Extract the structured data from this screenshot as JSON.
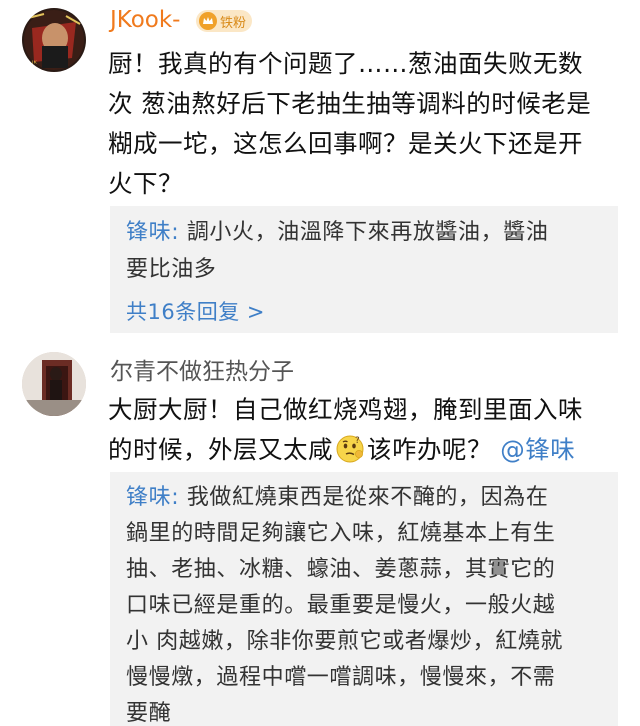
{
  "comments": [
    {
      "username": "JKook-",
      "badge": "铁粉",
      "text": "厨！我真的有个问题了……葱油面失败无数次 葱油熬好后下老抽生抽等调料的时候老是糊成一坨，这怎么回事啊？是关火下还是开火下？",
      "text_lines": [
        "厨！我真的有个问题了……葱油面失败无数",
        "次 葱油熬好后下老抽生抽等调料的时候老是",
        "糊成一坨，这怎么回事啊？是关火下还是开",
        "火下？"
      ],
      "reply": {
        "author": "锋味",
        "separator": ": ",
        "text_lines": [
          "調小火，油溫降下來再放醬油，醬油",
          "要比油多"
        ]
      },
      "more_replies": "共16条回复 >"
    },
    {
      "username": "尔青不做狂热分子",
      "text_lines_1": "大厨大厨！自己做红烧鸡翅，腌到里面入味",
      "text_line_2a": "的时候，外层又太咸",
      "emoji": "thinking-face-emoji",
      "text_line_2b": "该咋办呢？",
      "mention": "@锋味",
      "reply": {
        "author": "锋味",
        "separator": ": ",
        "text_lines": [
          "我做紅燒東西是從來不醃的，因為在",
          "鍋里的時間足夠讓它入味，紅燒基本上有生",
          "抽、老抽、冰糖、蠔油、姜蔥蒜，其實它的",
          "口味已經是重的。最重要是慢火，一般火越",
          "小 肉越嫩，除非你要煎它或者爆炒，紅燒就",
          "慢慢燉，過程中嚐一嚐調味，慢慢來，不需",
          "要醃"
        ]
      }
    }
  ],
  "colors": {
    "link": "#3f7fc7",
    "username_orange": "#f07a1d",
    "reply_bg": "#f2f2f2"
  }
}
